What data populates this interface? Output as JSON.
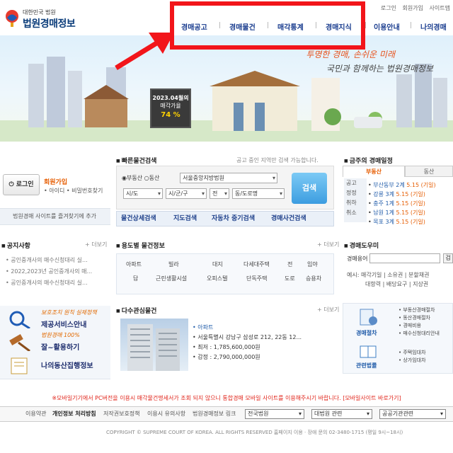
{
  "header": {
    "logo_small": "대한민국 법원",
    "logo_big": "법원경매정보",
    "util_links": [
      "로그인",
      "회원가입",
      "사이트맵"
    ],
    "gnb": [
      "경매공고",
      "경매물건",
      "매각통계",
      "경매지식",
      "이용안내",
      "나의경매"
    ]
  },
  "hero": {
    "slogan1": "투명한 경매, 손쉬운 미래",
    "slogan2": "국민과 함께하는 법원경매정보",
    "billboard_title": "2023.04월의",
    "billboard_label": "매각가율",
    "billboard_value": "74 %"
  },
  "login": {
    "button": "로그인",
    "join": "회원가입",
    "find": "• 아이디 • 비밀번호찾기",
    "favorite": "법원경매 사이트를 즐겨찾기에 추가"
  },
  "quick_search": {
    "title": "빠른물건검색",
    "notice": "공고 중인 지역만 검색 가능합니다.",
    "radio1": "부동산",
    "radio2": "동산",
    "court": "서울중앙지방법원",
    "sido": "시/도",
    "sigungu": "시/군/구",
    "all": "전",
    "dong": "동/도로명",
    "search_button": "검색",
    "links": [
      "물건상세검색",
      "지도검색",
      "자동차 중기검색",
      "경매사건검색"
    ]
  },
  "notices": {
    "title": "공지사항",
    "more": "+ 더보기",
    "items": [
      "공인중개사의 매수신청대리 실...",
      "2022,2023년 공인중개사의 매...",
      "공인중개사의 매수신청대리 실..."
    ]
  },
  "use_search": {
    "title": "용도별 물건정보",
    "more": "+ 더보기",
    "row1": [
      "아파트",
      "빌라",
      "대지",
      "다세대주택",
      "전",
      "임야"
    ],
    "row2": [
      "답",
      "근린생활시설",
      "오피스텔",
      "단독주택",
      "도로",
      "승용차"
    ]
  },
  "interest": {
    "title": "다수관심물건",
    "more": "+ 더보기",
    "type": "아파트",
    "address": "서울특별시 강남구 삼성로 212, 22동 12...",
    "min_price": "최저 : 1,785,600,000원",
    "appraisal": "감정 : 2,790,000,000원"
  },
  "promos": [
    {
      "small": "보호조치 원칙 실제정책",
      "large": "제공서비스안내"
    },
    {
      "small": "법원경매 100%",
      "large": "잘~활용하기"
    },
    {
      "small": "",
      "large": "나의동산집행정보"
    }
  ],
  "schedule": {
    "title": "금주의 경매일정",
    "tab1": "부동산",
    "tab2": "동산",
    "left_labels": [
      "공고",
      "정정",
      "취하",
      "취소"
    ],
    "items": [
      {
        "place": "부산동부",
        "count": "2계",
        "date": "5.15 (기일)"
      },
      {
        "place": "강릉",
        "count": "3계",
        "date": "5.15 (기일)"
      },
      {
        "place": "충주",
        "count": "1계",
        "date": "5.15 (기일)"
      },
      {
        "place": "남원",
        "count": "1계",
        "date": "5.15 (기일)"
      },
      {
        "place": "목포",
        "count": "3계",
        "date": "5.15 (기일)"
      }
    ]
  },
  "dictionary": {
    "title": "경매도우미",
    "label": "경매용어",
    "button": "검",
    "example_label": "예시:",
    "examples1": "매각기일 | 소유권 | 분할채권",
    "examples2": "대항력 | 배당요구 | 지상권"
  },
  "procedures": {
    "label1": "경매절차",
    "label2": "관련법률",
    "list1": [
      "부동산경매절차",
      "동산경매절차",
      "경매비용",
      "매수신청대리안내"
    ],
    "list2": [
      "주택임대차",
      "상가임대차"
    ]
  },
  "footer": {
    "notice": "※모바일기기에서 PC버전을 이용시 매각물건명세서가 조회 되지 않으니 통합경매 모바일 사이트를 이용해주시기 바랍니다. [모바일사이트 바로가기]",
    "links": [
      "이용약관",
      "개인정보 처리방침",
      "저작권보호정책",
      "이용시 유의사항",
      "법원경매정보 링크"
    ],
    "select1": "전국법원",
    "select2": "대법원 관련",
    "select3": "공공기관관련",
    "copyright": "COPYRIGHT © SUPREME COURT OF KOREA. ALL RIGHTS RESERVED    홈페이지 이용 · 장애 문의 02-3480-1715 (평일 9시~18시)"
  },
  "colors": {
    "accent_red": "#f2151a",
    "nav_blue": "#1a3d8f",
    "orange": "#e65c00"
  }
}
